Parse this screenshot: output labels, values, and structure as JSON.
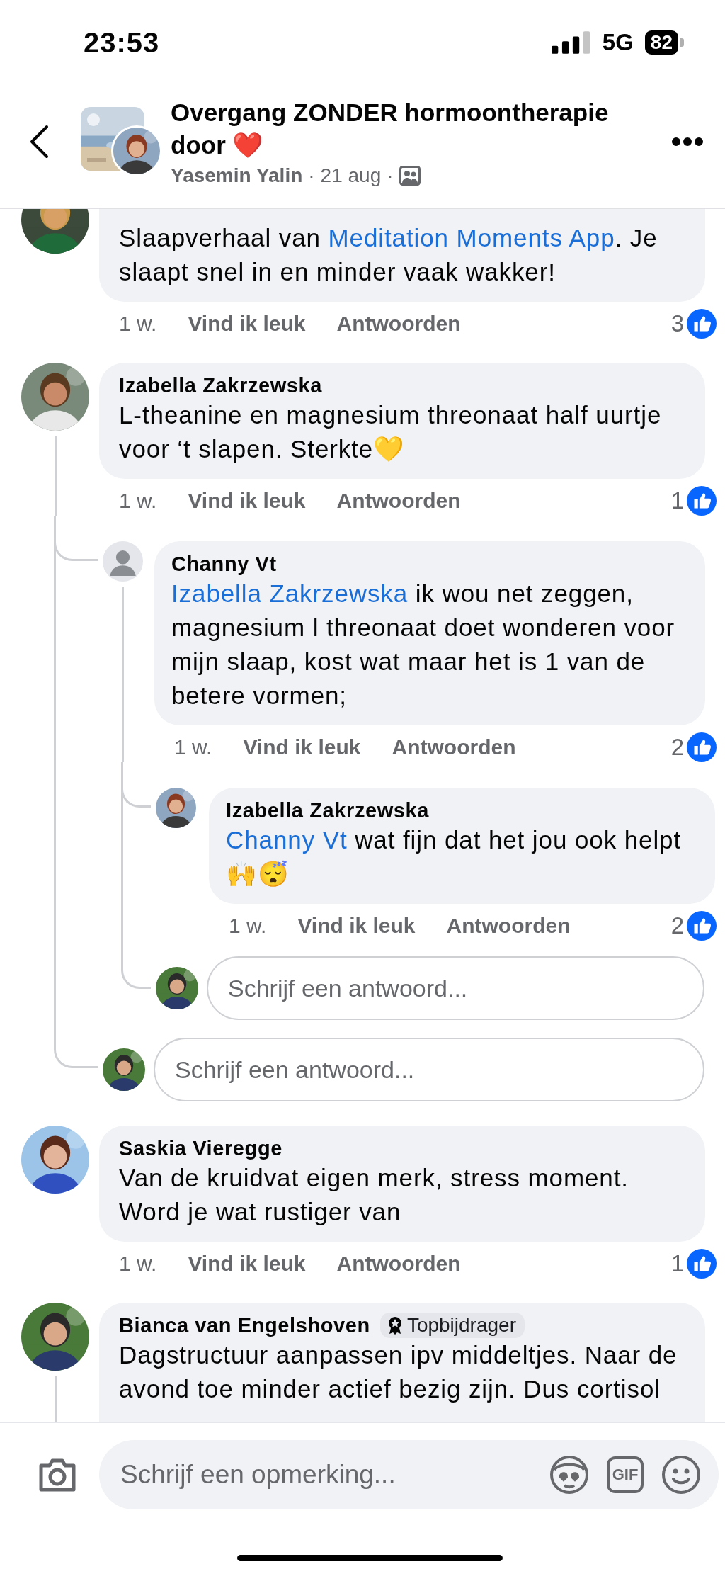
{
  "status_bar": {
    "time": "23:53",
    "network": "5G",
    "battery": "82"
  },
  "header": {
    "title": "Overgang ZONDER hormoontherapie door ❤️",
    "author": "Yasemin Yalin",
    "date": "21 aug",
    "separators": [
      "·",
      "·"
    ]
  },
  "comments": [
    {
      "kind": "comment",
      "avatar": {
        "kind": "picture"
      },
      "thread": false,
      "text": [
        {
          "kind": "text",
          "text": "Slaapverhaal van "
        },
        {
          "kind": "link",
          "text": "Meditation Moments App"
        },
        {
          "kind": "text",
          "text": ". Je slaapt snel in en minder vaak wakker!"
        }
      ],
      "time": "1 w.",
      "actions": [
        "Vind ik leuk",
        "Antwoorden"
      ],
      "likes": "3"
    },
    {
      "kind": "comment",
      "author": "Izabella Zakrzewska",
      "avatar": {
        "kind": "picture"
      },
      "thread": true,
      "text": [
        {
          "kind": "text",
          "text": "L-theanine en magnesium threonaat half uurtje voor ‘t slapen. Sterkte💛"
        }
      ],
      "time": "1 w.",
      "actions": [
        "Vind ik leuk",
        "Antwoorden"
      ],
      "likes": "1",
      "replies": [
        {
          "kind": "comment",
          "author": "Channy Vt",
          "avatar": {
            "kind": "default"
          },
          "thread": true,
          "text": [
            {
              "kind": "link",
              "text": "Izabella Zakrzewska"
            },
            {
              "kind": "text",
              "text": " ik wou net zeggen, magnesium l threonaat doet wonderen voor mijn slaap, kost wat maar het is 1 van de betere vormen;"
            }
          ],
          "time": "1 w.",
          "actions": [
            "Vind ik leuk",
            "Antwoorden"
          ],
          "likes": "2",
          "replies": [
            {
              "kind": "comment",
              "author": "Izabella Zakrzewska",
              "avatar": {
                "kind": "picture"
              },
              "thread": false,
              "text": [
                {
                  "kind": "link",
                  "text": "Channy Vt"
                },
                {
                  "kind": "text",
                  "text": " wat fijn dat het jou ook helpt 🙌😴"
                }
              ],
              "time": "1 w.",
              "actions": [
                "Vind ik leuk",
                "Antwoorden"
              ],
              "likes": "2"
            },
            {
              "kind": "input",
              "placeholder": "Schrijf een antwoord..."
            }
          ]
        },
        {
          "kind": "input",
          "placeholder": "Schrijf een antwoord..."
        }
      ]
    },
    {
      "kind": "comment",
      "author": "Saskia Vieregge",
      "avatar": {
        "kind": "picture"
      },
      "thread": false,
      "text": [
        {
          "kind": "text",
          "text": "Van de kruidvat eigen merk, stress moment. Word je wat rustiger van"
        }
      ],
      "time": "1 w.",
      "actions": [
        "Vind ik leuk",
        "Antwoorden"
      ],
      "likes": "1"
    },
    {
      "kind": "comment",
      "author": "Bianca van Engelshoven",
      "badge": "Topbijdrager",
      "avatar": {
        "kind": "picture"
      },
      "thread": true,
      "text": [
        {
          "kind": "text",
          "text": "Dagstructuur aanpassen ipv middeltjes. Naar de avond toe minder actief bezig zijn. Dus cortisol"
        }
      ]
    }
  ],
  "composer": {
    "placeholder": "Schrijf een opmerking...",
    "gif": "GIF"
  }
}
